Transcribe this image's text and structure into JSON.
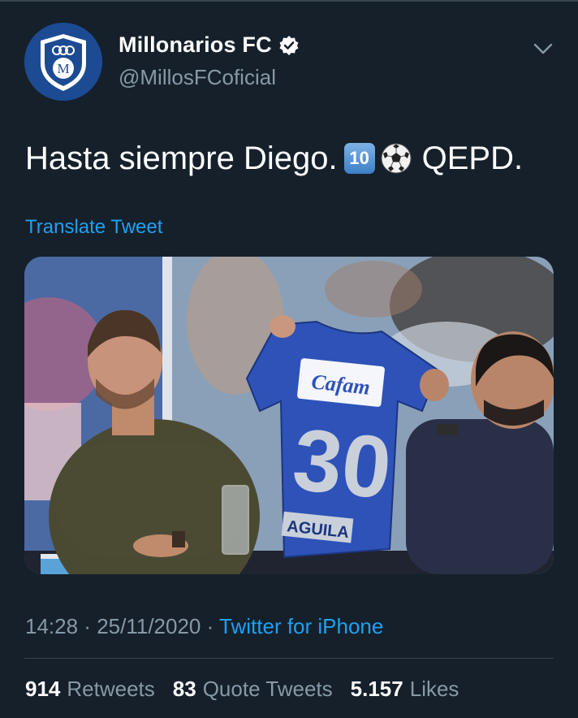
{
  "account": {
    "display_name": "Millonarios FC",
    "handle": "@MillosFCoficial",
    "verified": true,
    "avatar_icon": "club-crest-icon",
    "avatar_letter": "M"
  },
  "tweet": {
    "text_before": "Hasta siempre Diego.",
    "keycap_emoji": "10",
    "ball_emoji": "soccer-ball-icon",
    "text_after": "QEPD.",
    "translate_label": "Translate Tweet"
  },
  "media": {
    "jersey_brand": "Cafam",
    "jersey_number": "30",
    "jersey_name": "AGUILA"
  },
  "meta": {
    "time": "14:28",
    "separator": " · ",
    "date": "25/11/2020",
    "source": "Twitter for iPhone"
  },
  "stats": {
    "retweets_count": "914",
    "retweets_label": "Retweets",
    "quotes_count": "83",
    "quotes_label": "Quote Tweets",
    "likes_count": "5.157",
    "likes_label": "Likes"
  },
  "colors": {
    "background": "#15202b",
    "accent": "#1da1f2",
    "secondary_text": "#8899a6",
    "divider": "#38444d"
  }
}
